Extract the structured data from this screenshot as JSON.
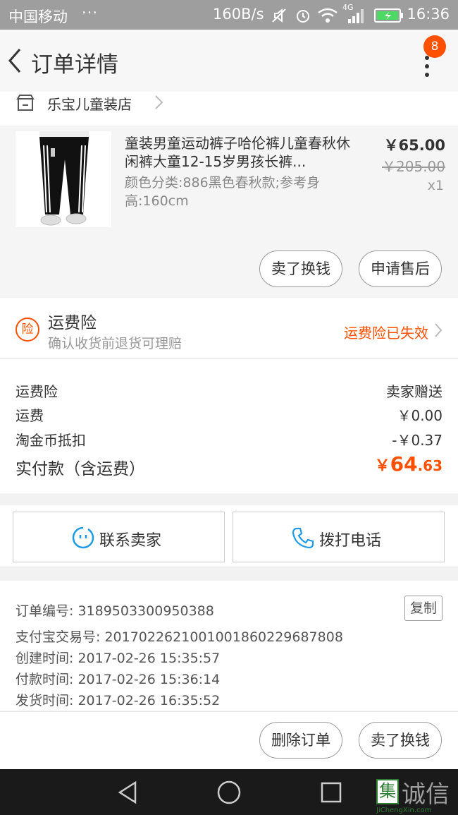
{
  "status_bar": {
    "carrier": "中国移动",
    "dots": "···",
    "speed": "160B/s",
    "network": "4G",
    "time": "16:36"
  },
  "nav": {
    "title": "订单详情",
    "badge_count": "8"
  },
  "shop": {
    "name": "乐宝儿童装店"
  },
  "item": {
    "title": "童装男童运动裤子哈伦裤儿童春秋休闲裤大童12-15岁男孩长裤...",
    "spec": "颜色分类:886黑色春秋款;参考身高:160cm",
    "price": "￥65.00",
    "original_price": "￥205.00",
    "quantity": "x1",
    "buttons": [
      "卖了换钱",
      "申请售后"
    ]
  },
  "insurance": {
    "icon_text": "险",
    "title": "运费险",
    "subtitle": "确认收货前退货可理赔",
    "status": "运费险已失效"
  },
  "fees": [
    {
      "label": "运费险",
      "value": "卖家赠送"
    },
    {
      "label": "运费",
      "value": "￥0.00"
    },
    {
      "label": "淘金币抵扣",
      "value": "-￥0.37"
    }
  ],
  "total": {
    "label": "实付款（含运费）",
    "symbol": "￥",
    "integer": "64",
    "decimal": ".63"
  },
  "contact": {
    "seller_label": "联系卖家",
    "phone_label": "拨打电话"
  },
  "order_info": {
    "order_no": "订单编号: 3189503300950388",
    "copy_label": "复制",
    "alipay_no": "支付宝交易号: 2017022621001001860229687808",
    "created": "创建时间: 2017-02-26 15:35:57",
    "paid": "付款时间: 2017-02-26 15:36:14",
    "shipped": "发货时间: 2017-02-26 16:35:52"
  },
  "actions": [
    "删除订单",
    "卖了换钱"
  ],
  "watermark": {
    "logo_char": "集",
    "text": "诚信",
    "url": "JiChengXin.com"
  },
  "colors": {
    "accent": "#ff5000",
    "status_bar": "#9e9e9e",
    "nav_bar": "#1a1a1a"
  }
}
